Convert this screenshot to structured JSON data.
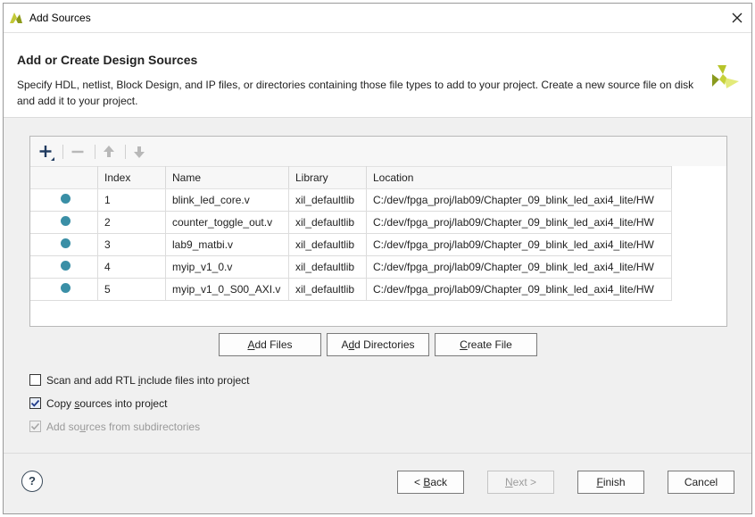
{
  "window": {
    "title": "Add Sources",
    "app_icon": "xilinx-logo-icon",
    "close_icon": "close-icon"
  },
  "header": {
    "title": "Add or Create Design Sources",
    "description": "Specify HDL, netlist, Block Design, and IP files, or directories containing those file types to add to your project. Create a new source file on disk and add it to your project.",
    "logo": "vivado-logo-icon"
  },
  "toolbar": {
    "add": "plus-icon",
    "remove": "minus-icon",
    "move_up": "arrow-up-icon",
    "move_down": "arrow-down-icon"
  },
  "table": {
    "columns": [
      "",
      "Index",
      "Name",
      "Library",
      "Location"
    ],
    "rows": [
      {
        "index": "1",
        "name": "blink_led_core.v",
        "library": "xil_defaultlib",
        "location": "C:/dev/fpga_proj/lab09/Chapter_09_blink_led_axi4_lite/HW"
      },
      {
        "index": "2",
        "name": "counter_toggle_out.v",
        "library": "xil_defaultlib",
        "location": "C:/dev/fpga_proj/lab09/Chapter_09_blink_led_axi4_lite/HW"
      },
      {
        "index": "3",
        "name": "lab9_matbi.v",
        "library": "xil_defaultlib",
        "location": "C:/dev/fpga_proj/lab09/Chapter_09_blink_led_axi4_lite/HW"
      },
      {
        "index": "4",
        "name": "myip_v1_0.v",
        "library": "xil_defaultlib",
        "location": "C:/dev/fpga_proj/lab09/Chapter_09_blink_led_axi4_lite/HW"
      },
      {
        "index": "5",
        "name": "myip_v1_0_S00_AXI.v",
        "library": "xil_defaultlib",
        "location": "C:/dev/fpga_proj/lab09/Chapter_09_blink_led_axi4_lite/HW"
      }
    ],
    "status_color": "#3a8fa6"
  },
  "actions": {
    "add_files": {
      "pre": "",
      "u": "A",
      "post": "dd Files"
    },
    "add_directories": {
      "pre": "A",
      "u": "d",
      "post": "d Directories"
    },
    "create_file": {
      "pre": "",
      "u": "C",
      "post": "reate File"
    }
  },
  "options": {
    "scan_rtl": {
      "pre": "Scan and add RTL ",
      "u": "i",
      "post": "nclude files into project",
      "checked": false,
      "enabled": true
    },
    "copy_sources": {
      "pre": "Copy ",
      "u": "s",
      "post": "ources into project",
      "checked": true,
      "enabled": true
    },
    "add_subdirs": {
      "pre": "Add so",
      "u": "u",
      "post": "rces from subdirectories",
      "checked": true,
      "enabled": false
    }
  },
  "footer": {
    "help": "?",
    "back": {
      "pre": "< ",
      "u": "B",
      "post": "ack"
    },
    "next": {
      "pre": "",
      "u": "N",
      "post": "ext >"
    },
    "finish": {
      "pre": "",
      "u": "F",
      "post": "inish"
    },
    "cancel": "Cancel"
  }
}
